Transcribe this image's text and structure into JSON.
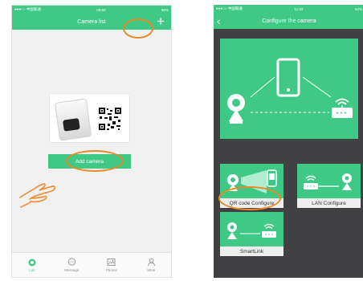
{
  "left_screen": {
    "status": {
      "carrier": "●●●○○ 中国联通 ",
      "time": "09:50",
      "battery": "90%"
    },
    "title": "Camera list",
    "add_icon": "plus-icon",
    "add_camera_label": "Add camera",
    "tabs": [
      {
        "label": "List",
        "icon": "list-icon",
        "active": true
      },
      {
        "label": "Message",
        "icon": "message-icon",
        "active": false
      },
      {
        "label": "Photos",
        "icon": "photos-icon",
        "active": false
      },
      {
        "label": "Mine",
        "icon": "person-icon",
        "active": false
      }
    ]
  },
  "right_screen": {
    "status": {
      "carrier": "●●●○○ 中国联通 ",
      "time": "11:02",
      "battery": "82%"
    },
    "title": "Configure the camera",
    "options": [
      {
        "label": "QR code Configure",
        "icon": "qr-configure-icon"
      },
      {
        "label": "LAN Configure",
        "icon": "lan-configure-icon"
      },
      {
        "label": "SmartLink",
        "icon": "smartlink-icon"
      }
    ]
  },
  "colors": {
    "accent": "#3fc985",
    "highlight": "#e98a27",
    "dark_bg": "#414042"
  }
}
